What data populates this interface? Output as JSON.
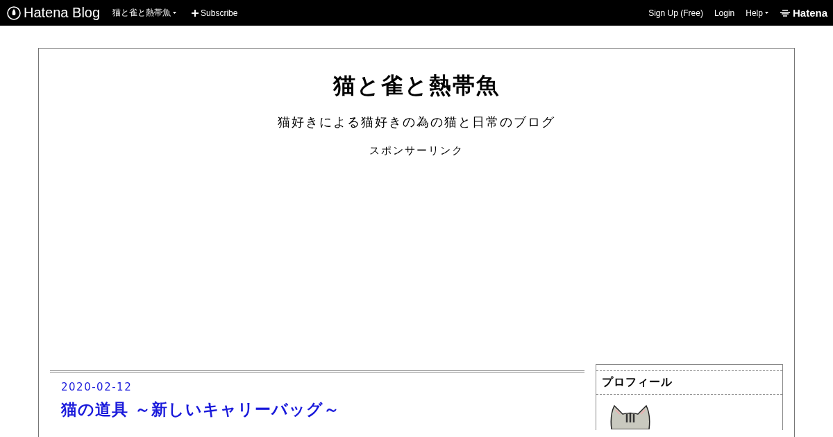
{
  "navbar": {
    "brand": "Hatena Blog",
    "blog_menu": "猫と雀と熱帯魚",
    "subscribe": "Subscribe",
    "links": [
      "Sign Up (Free)",
      "Login"
    ],
    "help": "Help",
    "hatena": "Hatena"
  },
  "header": {
    "title": "猫と雀と熱帯魚",
    "description": "猫好きによる猫好きの為の猫と日常のブログ",
    "sponsored": "スポンサーリンク"
  },
  "entry": {
    "date": "2020-02-12",
    "title": "猫の道具 ～新しいキャリーバッグ～"
  },
  "sidebar": {
    "module_title": "プロフィール"
  }
}
